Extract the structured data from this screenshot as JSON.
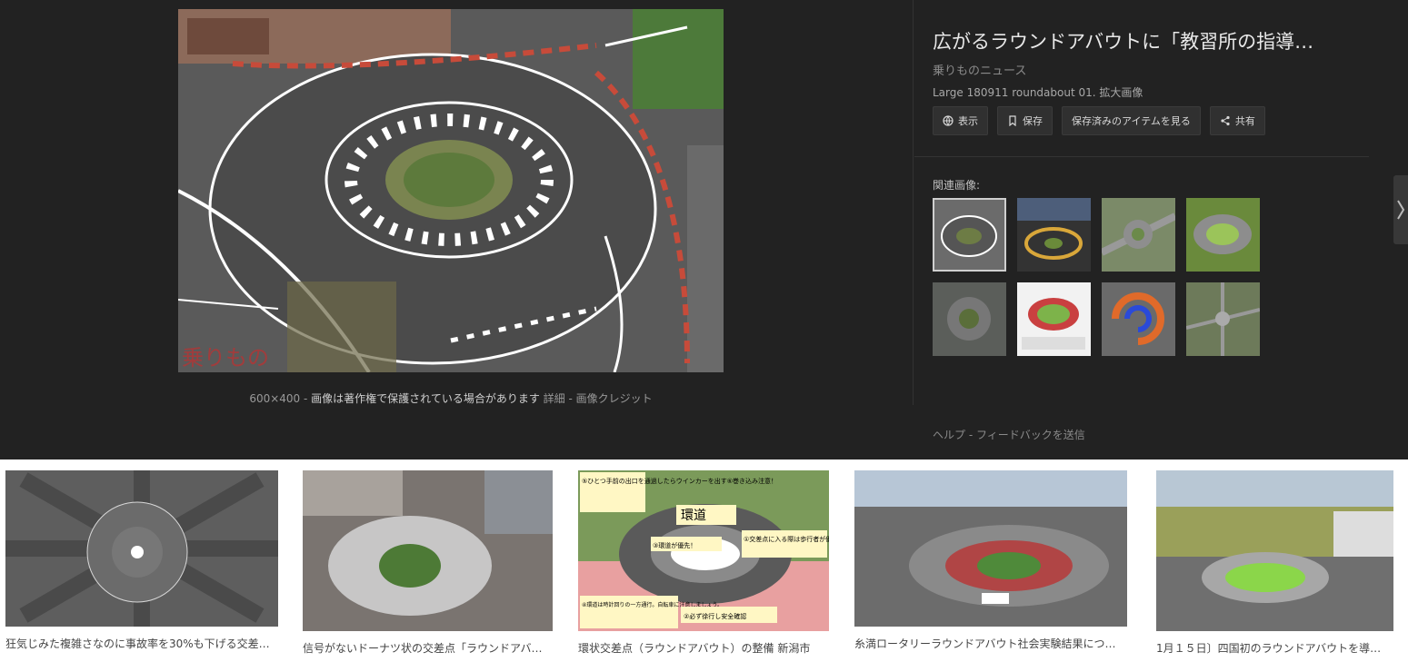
{
  "viewer": {
    "title": "広がるラウンドアバウトに「教習所の指導…",
    "source": "乗りものニュース",
    "subline": "Large 180911 roundabout 01. 拡大画像",
    "size": "600×400",
    "copyright_note": "画像は著作権で保護されている場合があります",
    "details_link": "詳細",
    "credit_link": "画像クレジット",
    "buttons": {
      "view": "表示",
      "save": "保存",
      "saved_items": "保存済みのアイテムを見る",
      "share": "共有"
    },
    "related_label": "関連画像:",
    "footer_help": "ヘルプ",
    "footer_feedback": "フィードバックを送信",
    "watermark": "乗りもの"
  },
  "results": [
    {
      "caption": "狂気じみた複雑さなのに事故率を30%も下げる交差…"
    },
    {
      "caption": "信号がないドーナツ状の交差点「ラウンドアバ…"
    },
    {
      "caption": "環状交差点（ラウンドアバウト）の整備 新潟市"
    },
    {
      "caption": "糸満ロータリーラウンドアバウト社会実験結果につ…"
    },
    {
      "caption": "1月１５日〕四国初のラウンドアバウトを導…"
    }
  ],
  "diagram_labels": {
    "ring": "環道",
    "note1": "①交差点に入る際は歩行者が優先！",
    "note2": "②必ず徐行し安全確認",
    "note3": "③環道が優先！",
    "note4": "④環道は時計回りの一方通行。自転車に注意しましょう。",
    "note5": "⑤ひとつ手前の出口を通過したらウインカーを出す⑥巻き込み注意！"
  },
  "colors": {
    "panel_bg": "#222222",
    "text_light": "#e8e8e8",
    "text_muted": "#8a8a8a"
  }
}
